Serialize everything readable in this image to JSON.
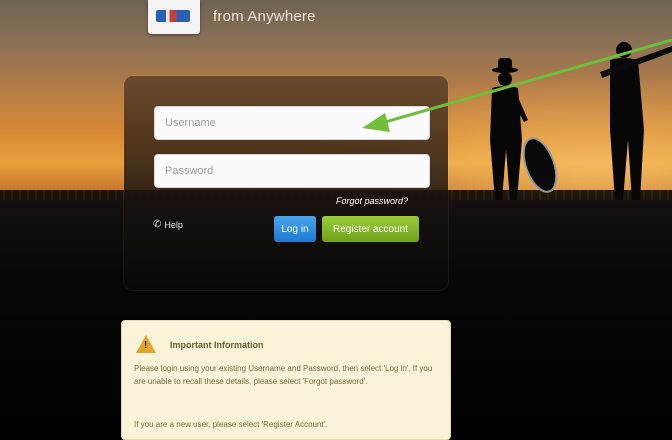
{
  "header": {
    "tagline": "from Anywhere"
  },
  "login": {
    "username_placeholder": "Username",
    "password_placeholder": "Password",
    "forgot_label": "Forgot password?",
    "help_label": "Help",
    "login_label": "Log in",
    "register_label": "Register account"
  },
  "info": {
    "title": "Important Information",
    "paragraph1": "Please login using your existing Username and Password, then select 'Log in'. If you are unable to recall these details, please select 'Forgot password'.",
    "paragraph2": "If you are a new user, please select 'Register Account'."
  },
  "annotation": {
    "arrow_color": "#6fbf3a"
  },
  "colors": {
    "login_button": "#2a86d9",
    "register_button": "#86b82c",
    "warning": "#e0a52a"
  }
}
